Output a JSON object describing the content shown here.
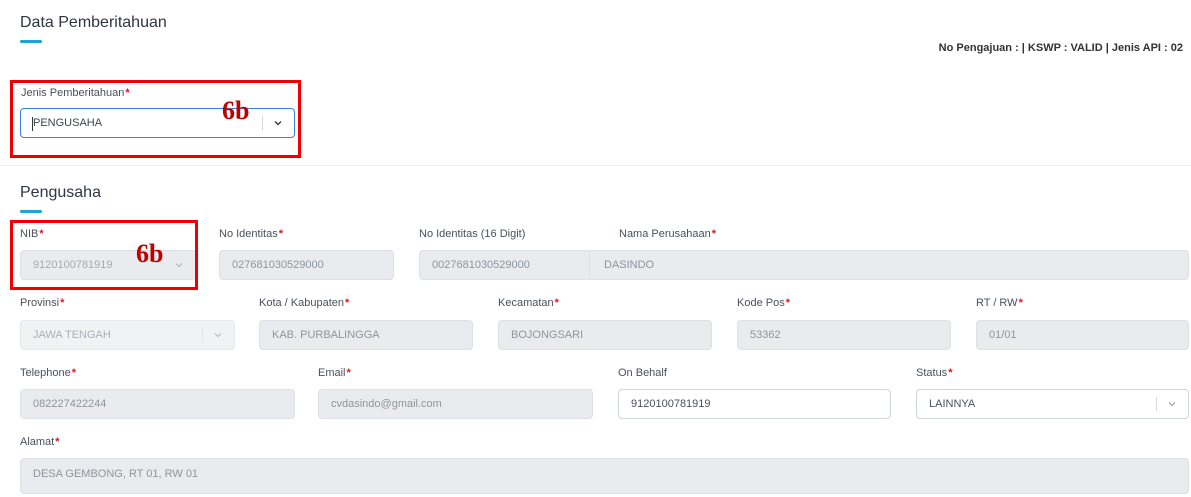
{
  "header": {
    "title": "Data Pemberitahuan",
    "info": "No Pengajuan : | KSWP : VALID | Jenis API : 02"
  },
  "jenis": {
    "label": "Jenis Pemberitahuan",
    "value": "PENGUSAHA"
  },
  "pengusaha": {
    "title": "Pengusaha",
    "nib": {
      "label": "NIB",
      "value": "9120100781919"
    },
    "no_identitas": {
      "label": "No Identitas",
      "value": "027681030529000"
    },
    "no_identitas_16": {
      "label": "No Identitas (16 Digit)",
      "value": "0027681030529000"
    },
    "nama_perusahaan": {
      "label": "Nama Perusahaan",
      "value": "DASINDO"
    },
    "provinsi": {
      "label": "Provinsi",
      "value": "JAWA TENGAH"
    },
    "kota": {
      "label": "Kota / Kabupaten",
      "value": "KAB. PURBALINGGA"
    },
    "kecamatan": {
      "label": "Kecamatan",
      "value": "BOJONGSARI"
    },
    "kode_pos": {
      "label": "Kode Pos",
      "value": "53362"
    },
    "rt_rw": {
      "label": "RT / RW",
      "value": "01/01"
    },
    "telephone": {
      "label": "Telephone",
      "value": "082227422244"
    },
    "email": {
      "label": "Email",
      "value": "cvdasindo@gmail.com"
    },
    "on_behalf": {
      "label": "On Behalf",
      "value": "9120100781919"
    },
    "status": {
      "label": "Status",
      "value": "LAINNYA"
    },
    "alamat": {
      "label": "Alamat",
      "value": "DESA GEMBONG, RT 01, RW 01"
    }
  },
  "annotations": {
    "label1": "6b",
    "label2": "6b"
  },
  "colors": {
    "accent": "#1fa2d8",
    "required": "#d81919",
    "annotation": "#ee0000"
  },
  "icons": {
    "dropdown": "chevron-down-icon"
  }
}
